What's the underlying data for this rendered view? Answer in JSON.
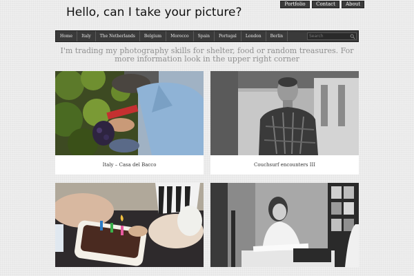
{
  "site": {
    "title": "Hello, can I take your picture?",
    "intro": "I'm trading my photography skills for shelter, food or random treasures. For more information look in the upper right corner"
  },
  "top_links": [
    "Portfolio",
    "Contact",
    "About"
  ],
  "nav": {
    "items": [
      "Home",
      "Italy",
      "The Netherlands",
      "Belgium",
      "Morocco",
      "Spain",
      "Portugal",
      "London",
      "Berlin"
    ],
    "search_placeholder": "Search"
  },
  "posts": [
    {
      "caption": "Italy – Casa del Bacco",
      "icon": "photo-grape-harvest"
    },
    {
      "caption": "Couchsurf encounters III",
      "icon": "photo-portrait-man"
    },
    {
      "caption": "",
      "icon": "photo-birthday-cake"
    },
    {
      "caption": "",
      "icon": "photo-woman-reading"
    }
  ]
}
